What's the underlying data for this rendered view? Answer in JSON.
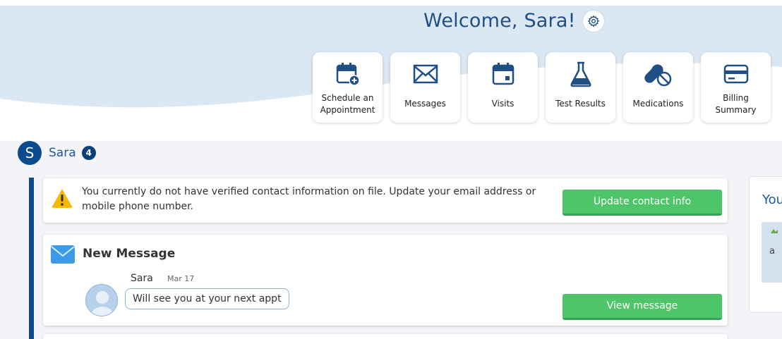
{
  "header": {
    "welcome": "Welcome, Sara!",
    "tiles": [
      {
        "label": "Schedule an Appointment",
        "icon": "calendar-plus-icon"
      },
      {
        "label": "Messages",
        "icon": "envelope-icon"
      },
      {
        "label": "Visits",
        "icon": "calendar-icon"
      },
      {
        "label": "Test Results",
        "icon": "flask-icon"
      },
      {
        "label": "Medications",
        "icon": "pill-icon"
      },
      {
        "label": "Billing Summary",
        "icon": "credit-card-icon"
      }
    ]
  },
  "user": {
    "initial": "S",
    "name": "Sara",
    "badge_count": "4"
  },
  "alert": {
    "text": "You currently do not have verified contact information on file. Update your email address or mobile phone number.",
    "button": "Update contact info"
  },
  "message": {
    "title": "New Message",
    "sender": "Sara",
    "date": "Mar 17",
    "preview": "Will see you at your next appt",
    "button": "View message"
  },
  "side_panel": {
    "title": "You",
    "image_text": "a"
  },
  "colors": {
    "brand_dark": "#0b4a8b",
    "brand_text": "#1f4f84",
    "accent_green": "#4fc56a",
    "hero_bg": "#dbe8f4"
  }
}
